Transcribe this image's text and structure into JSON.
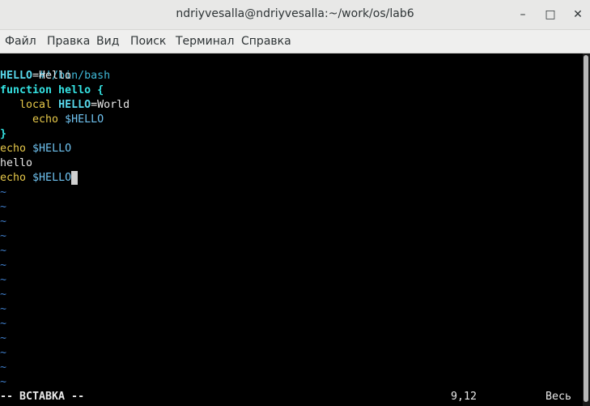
{
  "window": {
    "title": "ndriyvesalla@ndriyvesalla:~/work/os/lab6",
    "btn_min": "–",
    "btn_max": "□",
    "btn_close": "✕"
  },
  "menu": {
    "file": "Файл",
    "edit": "Правка",
    "view": "Вид",
    "search": "Поиск",
    "terminal": "Терминал",
    "help": "Справка"
  },
  "editor": {
    "l1": "#!/bin/bash",
    "l2_var": "HELLO",
    "l2_rest": "=Hello",
    "l3": "function hello {",
    "l4_kw": "local",
    "l4_var": "HELLO",
    "l4_rest": "=World",
    "l5_cmd": "echo",
    "l5_arg": "$HELLO",
    "l6": "}",
    "l7_cmd": "echo",
    "l7_arg": "$HELLO",
    "l8": "hello",
    "l9_cmd": "echo",
    "l9_arg": "$HELLO",
    "tilde": "~"
  },
  "status": {
    "mode": "-- ВСТАВКА --",
    "position": "9,12",
    "scroll": "Весь"
  }
}
